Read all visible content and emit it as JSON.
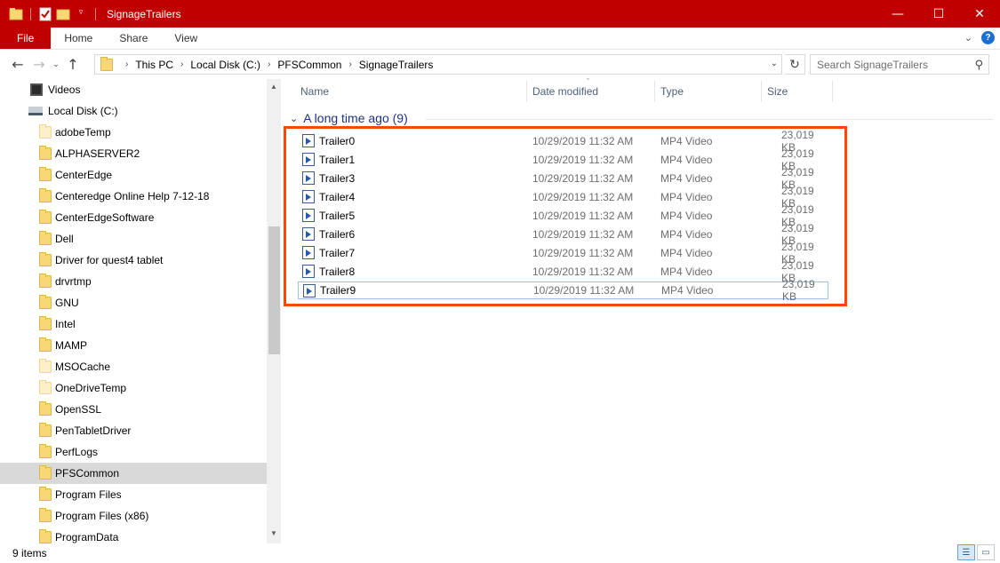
{
  "window": {
    "title": "SignageTrailers",
    "minimize": "—",
    "maximize": "☐",
    "close": "✕",
    "accent": "#c00000"
  },
  "ribbon": {
    "tabs": [
      "File",
      "Home",
      "Share",
      "View"
    ]
  },
  "address": {
    "crumbs": [
      "This PC",
      "Local Disk (C:)",
      "PFSCommon",
      "SignageTrailers"
    ],
    "search_placeholder": "Search SignageTrailers"
  },
  "nav": {
    "items": [
      {
        "label": "Videos",
        "icon": "video-library-icon"
      },
      {
        "label": "Local Disk (C:)",
        "icon": "drive-icon"
      },
      {
        "label": "adobeTemp",
        "icon": "folder-icon-light"
      },
      {
        "label": "ALPHASERVER2",
        "icon": "folder-icon"
      },
      {
        "label": "CenterEdge",
        "icon": "folder-icon"
      },
      {
        "label": "Centeredge Online Help 7-12-18",
        "icon": "folder-icon"
      },
      {
        "label": "CenterEdgeSoftware",
        "icon": "folder-icon"
      },
      {
        "label": "Dell",
        "icon": "folder-icon"
      },
      {
        "label": "Driver for quest4 tablet",
        "icon": "folder-icon"
      },
      {
        "label": "drvrtmp",
        "icon": "folder-icon"
      },
      {
        "label": "GNU",
        "icon": "folder-icon"
      },
      {
        "label": "Intel",
        "icon": "folder-icon"
      },
      {
        "label": "MAMP",
        "icon": "folder-icon"
      },
      {
        "label": "MSOCache",
        "icon": "folder-icon-light"
      },
      {
        "label": "OneDriveTemp",
        "icon": "folder-icon-light"
      },
      {
        "label": "OpenSSL",
        "icon": "folder-icon"
      },
      {
        "label": "PenTabletDriver",
        "icon": "folder-icon"
      },
      {
        "label": "PerfLogs",
        "icon": "folder-icon"
      },
      {
        "label": "PFSCommon",
        "icon": "folder-icon",
        "selected": true
      },
      {
        "label": "Program Files",
        "icon": "folder-icon"
      },
      {
        "label": "Program Files (x86)",
        "icon": "folder-icon"
      },
      {
        "label": "ProgramData",
        "icon": "folder-icon"
      }
    ]
  },
  "columns": [
    "Name",
    "Date modified",
    "Type",
    "Size"
  ],
  "group": {
    "label": "A long time ago (9)"
  },
  "files": [
    {
      "name": "Trailer0",
      "date": "10/29/2019 11:32 AM",
      "type": "MP4 Video",
      "size": "23,019 KB"
    },
    {
      "name": "Trailer1",
      "date": "10/29/2019 11:32 AM",
      "type": "MP4 Video",
      "size": "23,019 KB"
    },
    {
      "name": "Trailer3",
      "date": "10/29/2019 11:32 AM",
      "type": "MP4 Video",
      "size": "23,019 KB"
    },
    {
      "name": "Trailer4",
      "date": "10/29/2019 11:32 AM",
      "type": "MP4 Video",
      "size": "23,019 KB"
    },
    {
      "name": "Trailer5",
      "date": "10/29/2019 11:32 AM",
      "type": "MP4 Video",
      "size": "23,019 KB"
    },
    {
      "name": "Trailer6",
      "date": "10/29/2019 11:32 AM",
      "type": "MP4 Video",
      "size": "23,019 KB"
    },
    {
      "name": "Trailer7",
      "date": "10/29/2019 11:32 AM",
      "type": "MP4 Video",
      "size": "23,019 KB"
    },
    {
      "name": "Trailer8",
      "date": "10/29/2019 11:32 AM",
      "type": "MP4 Video",
      "size": "23,019 KB"
    },
    {
      "name": "Trailer9",
      "date": "10/29/2019 11:32 AM",
      "type": "MP4 Video",
      "size": "23,019 KB"
    }
  ],
  "status": {
    "item_count": "9 items"
  },
  "highlight_color": "#ff4500"
}
